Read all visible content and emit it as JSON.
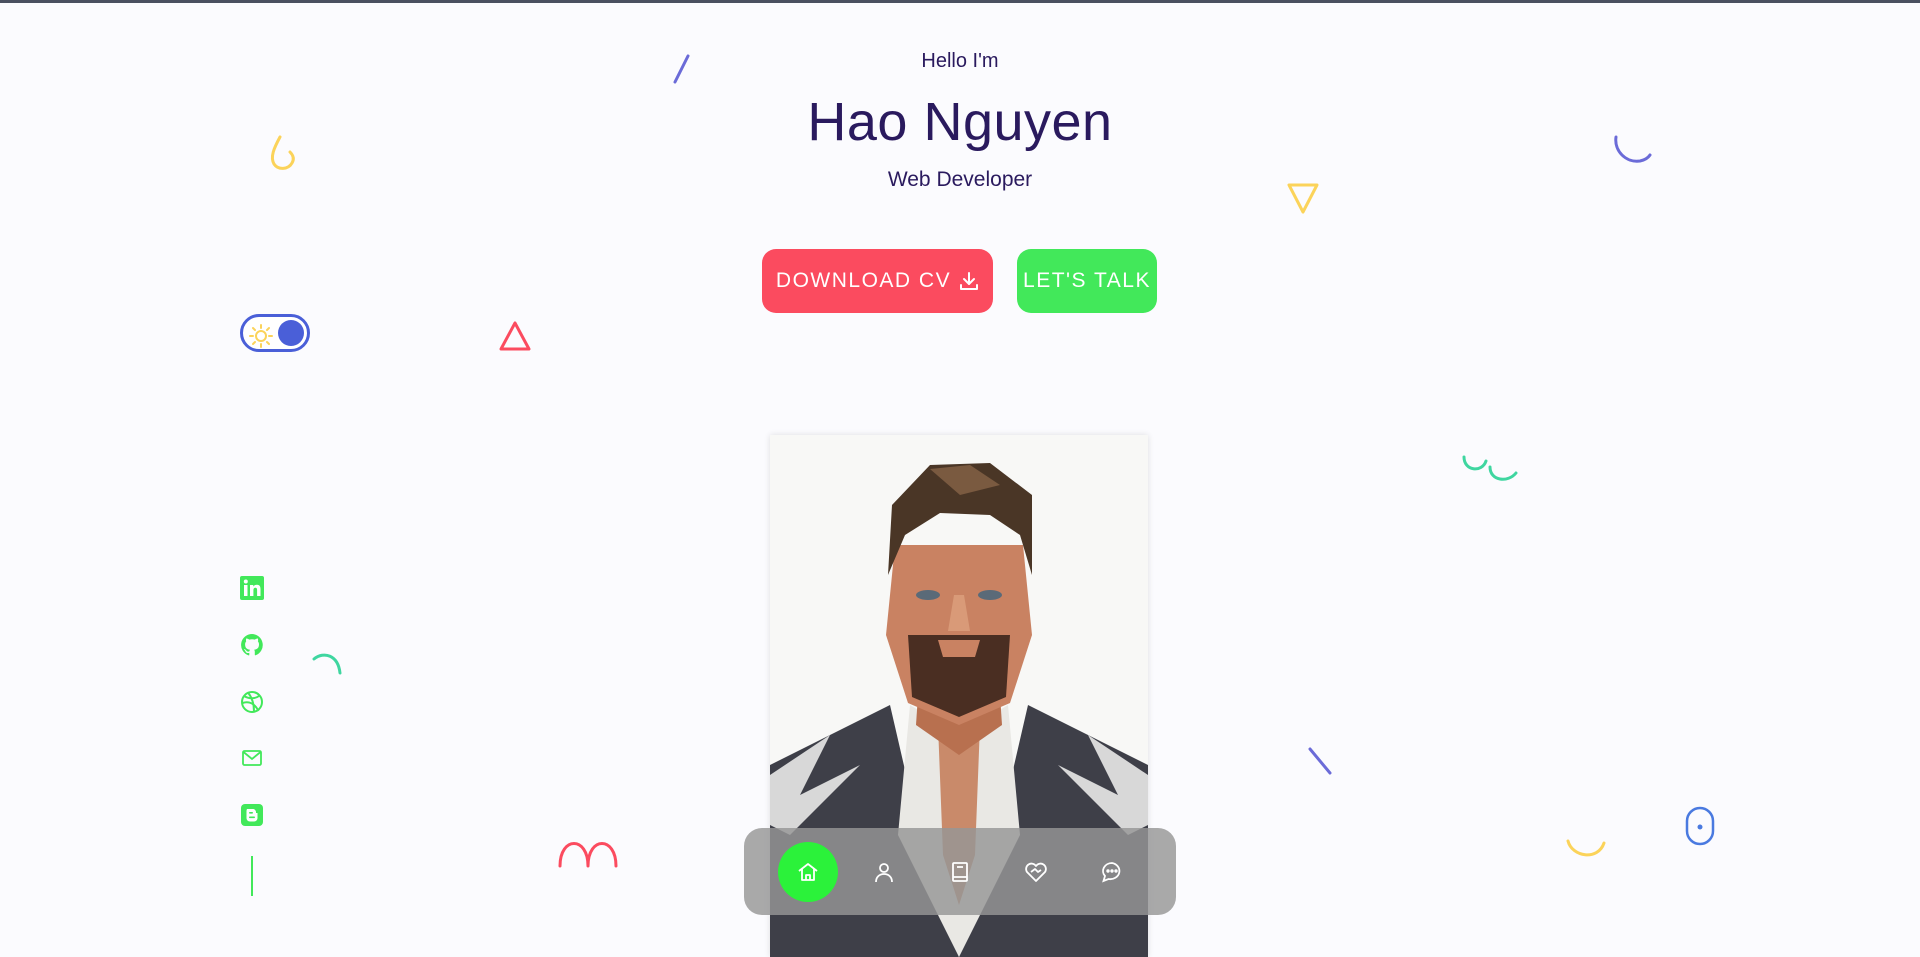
{
  "hero": {
    "greeting": "Hello I'm",
    "name": "Hao Nguyen",
    "role": "Web Developer"
  },
  "buttons": {
    "download_cv": "DOWNLOAD CV",
    "lets_talk": "LET'S TALK"
  },
  "theme_toggle": {
    "mode": "dark-on",
    "icon": "sun-icon"
  },
  "social": [
    {
      "name": "linkedin-icon"
    },
    {
      "name": "github-icon"
    },
    {
      "name": "dribbble-icon"
    },
    {
      "name": "mail-icon"
    },
    {
      "name": "blogger-icon"
    }
  ],
  "nav": {
    "items": [
      {
        "name": "home-icon",
        "active": true
      },
      {
        "name": "user-icon",
        "active": false
      },
      {
        "name": "book-icon",
        "active": false
      },
      {
        "name": "services-icon",
        "active": false
      },
      {
        "name": "chat-icon",
        "active": false
      }
    ]
  },
  "colors": {
    "primary_text": "#2a1a5e",
    "accent_red": "#fb4b5f",
    "accent_green": "#42e85a",
    "toggle_blue": "#4a5fd8",
    "decor_yellow": "#fbd35a",
    "decor_purple": "#6b6bd8",
    "decor_teal": "#3fd6a0"
  }
}
